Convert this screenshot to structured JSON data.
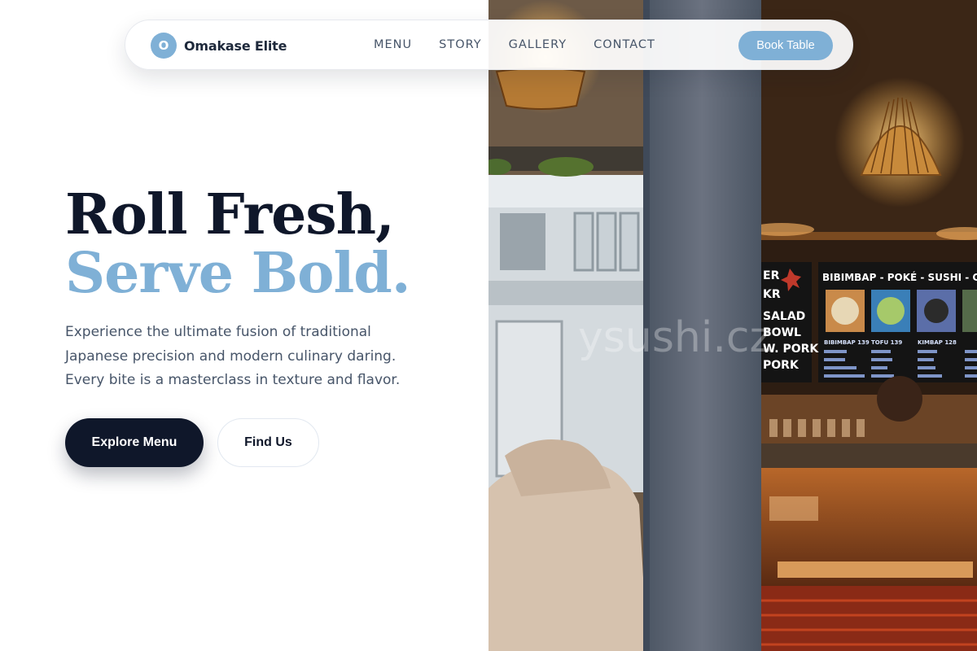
{
  "brand": {
    "initial": "O",
    "name": "Omakase Elite"
  },
  "nav": {
    "links": [
      "MENU",
      "STORY",
      "GALLERY",
      "CONTACT"
    ],
    "cta": "Book Table"
  },
  "hero": {
    "line1": "Roll Fresh,",
    "line2": "Serve Bold.",
    "paragraph": "Experience the ultimate fusion of traditional Japanese precision and modern culinary daring. Every bite is a masterclass in texture and flavor.",
    "primary_button": "Explore Menu",
    "secondary_button": "Find Us"
  },
  "photo": {
    "board_header": "BIBIMBAP - POKÉ - SUSHI - CURRY",
    "board_left_items": [
      "ER",
      "KR",
      "SALAD",
      "BOWL",
      "W. PORK",
      "PORK"
    ],
    "board_items": [
      "BIBIMBAP 139",
      "TOFU 139",
      "KIMBAP 128",
      ""
    ],
    "window_text": "ysushi.cz"
  },
  "colors": {
    "navy": "#0f172a",
    "accent": "#7fb0d6",
    "muted_text": "#475569"
  }
}
